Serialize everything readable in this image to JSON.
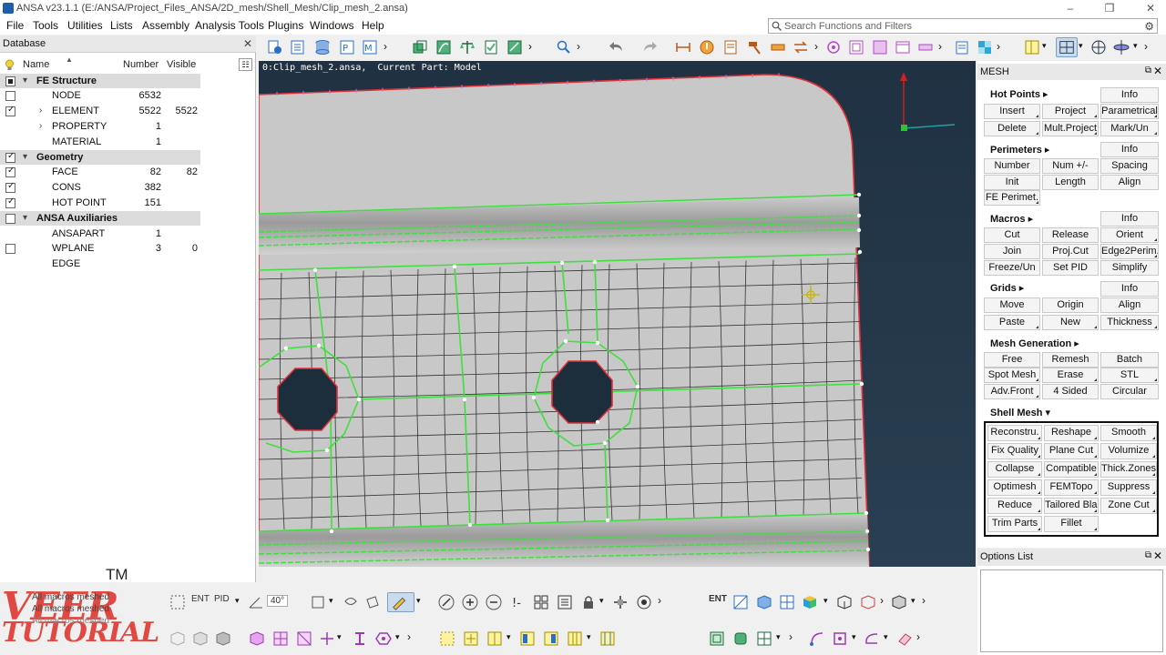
{
  "window": {
    "title": "ANSA v23.1.1 (E:/ANSA/Project_Files_ANSA/2D_mesh/Shell_Mesh/Clip_mesh_2.ansa)"
  },
  "menubar": [
    "File",
    "Tools",
    "Utilities",
    "Lists",
    "Assembly",
    "Analysis Tools",
    "Plugins",
    "Windows",
    "Help"
  ],
  "search": {
    "placeholder": "Search Functions and Filters"
  },
  "database": {
    "title": "Database",
    "columns": {
      "name": "Name",
      "number": "Number",
      "visible": "Visible"
    },
    "rows": [
      {
        "name": "FE Structure",
        "group": true,
        "number": "",
        "visible": ""
      },
      {
        "name": "NODE",
        "number": "6532",
        "visible": ""
      },
      {
        "name": "ELEMENT",
        "number": "5522",
        "visible": "5522"
      },
      {
        "name": "PROPERTY",
        "number": "1",
        "visible": ""
      },
      {
        "name": "MATERIAL",
        "number": "1",
        "visible": ""
      },
      {
        "name": "Geometry",
        "group": true,
        "number": "",
        "visible": ""
      },
      {
        "name": "FACE",
        "number": "82",
        "visible": "82"
      },
      {
        "name": "CONS",
        "number": "382",
        "visible": ""
      },
      {
        "name": "HOT POINT",
        "number": "151",
        "visible": ""
      },
      {
        "name": "ANSA Auxiliaries",
        "group": true,
        "number": "",
        "visible": ""
      },
      {
        "name": "ANSAPART",
        "number": "1",
        "visible": ""
      },
      {
        "name": "WPLANE",
        "number": "3",
        "visible": "0"
      },
      {
        "name": "EDGE",
        "number": "",
        "visible": ""
      }
    ]
  },
  "viewport": {
    "info": "0:Clip_mesh_2.ansa,  Current Part: Model"
  },
  "mesh_panel": {
    "title": "MESH",
    "hot_points": {
      "label": "Hot Points ▸",
      "buttons": [
        "Info",
        "Insert",
        "Project",
        "Parametrical",
        "Delete",
        "Mult.Project",
        "Mark/Un"
      ]
    },
    "perimeters": {
      "label": "Perimeters ▸",
      "buttons": [
        "Info",
        "Number",
        "Num +/-",
        "Spacing",
        "Init",
        "Length",
        "Align",
        "FE Perimet."
      ]
    },
    "macros": {
      "label": "Macros ▸",
      "buttons": [
        "Info",
        "Cut",
        "Release",
        "Orient",
        "Join",
        "Proj.Cut",
        "Edge2Perim.",
        "Freeze/Un",
        "Set PID",
        "Simplify"
      ]
    },
    "grids": {
      "label": "Grids ▸",
      "buttons": [
        "Info",
        "Move",
        "Origin",
        "Align",
        "Paste",
        "New",
        "Thickness"
      ]
    },
    "mesh_generation": {
      "label": "Mesh Generation ▸",
      "buttons": [
        "Free",
        "Remesh",
        "Batch",
        "Spot Mesh",
        "Erase",
        "STL",
        "Adv.Front",
        "4 Sided",
        "Circular"
      ]
    },
    "shell_mesh": {
      "label": "Shell Mesh ▾",
      "buttons": [
        "Reconstru.",
        "Reshape",
        "Smooth",
        "Fix Quality",
        "Plane Cut",
        "Volumize",
        "Collapse",
        "Compatible",
        "Thick.Zones",
        "Optimesh",
        "FEMTopo",
        "Suppress",
        "Reduce",
        "Tailored Bla.",
        "Zone Cut",
        "Trim Parts",
        "Fillet"
      ]
    }
  },
  "options_list": {
    "title": "Options List"
  },
  "bottom": {
    "ent_label": "ENT",
    "pid_label": "PID",
    "angle_value": "40°",
    "ent_label2": "ENT"
  },
  "messages": [
    "All macros meshed",
    "All macros meshed",
    "All macros meshed"
  ],
  "watermark": {
    "line1": "VEER",
    "line2": "TUTORIAL",
    "tm": "TM"
  },
  "colors": {
    "mesh_green": "#3ee03e",
    "part_gray": "#c6c6c6",
    "viewport_bg": "#23364a",
    "perimeter_red": "#e0303a"
  }
}
